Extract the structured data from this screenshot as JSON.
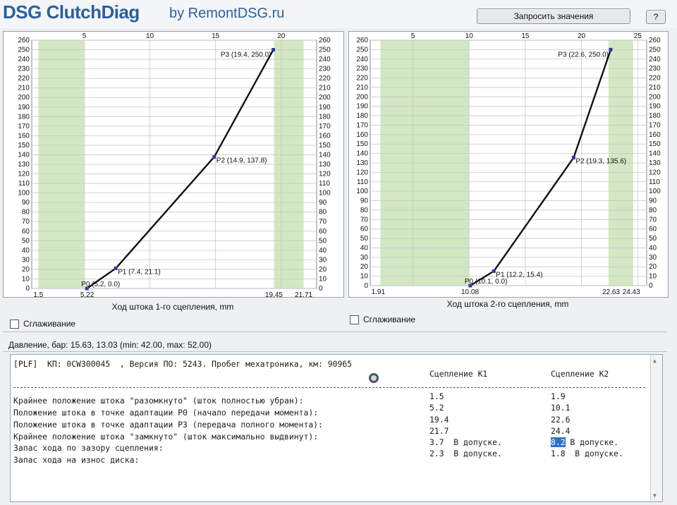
{
  "header": {
    "app_name": "DSG ClutchDiag",
    "app_by": "by RemontDSG.ru",
    "request_button": "Запросить значения",
    "help_button": "?"
  },
  "colors": {
    "brand": "#2b5f9c",
    "band": "#d2e8c3",
    "curve": "#111111",
    "grid": "#c8c8c8"
  },
  "chart_data": [
    {
      "type": "line",
      "xlabel": "Ход штока 1-го сцепления, mm",
      "x_ticks_top": [
        5,
        10,
        15,
        20
      ],
      "y_ticks": [
        0,
        10,
        20,
        30,
        40,
        50,
        60,
        70,
        80,
        90,
        100,
        110,
        120,
        130,
        140,
        150,
        160,
        170,
        180,
        190,
        200,
        210,
        220,
        230,
        240,
        250,
        260
      ],
      "xlim": [
        1.0,
        22.7
      ],
      "ylim": [
        0,
        260
      ],
      "bottom_markers": [
        "1.5",
        "5.22",
        "19.45",
        "21.71"
      ],
      "bottom_marker_values": [
        1.5,
        5.22,
        19.45,
        21.71
      ],
      "bands": [
        [
          1.5,
          5.0
        ],
        [
          19.45,
          21.71
        ]
      ],
      "series": [
        {
          "x": [
            5.2,
            7.4,
            14.9,
            19.4
          ],
          "y": [
            0.0,
            21.1,
            137.8,
            250.0
          ]
        }
      ],
      "point_labels": [
        "P0 (5.2, 0.0)",
        "P1 (7.4, 21.1)",
        "P2 (14.9, 137.8)",
        "P3 (19.4, 250.0)"
      ]
    },
    {
      "type": "line",
      "xlabel": "Ход штока 2-го сцепления, mm",
      "x_ticks_top": [
        5,
        10,
        15,
        20,
        25
      ],
      "y_ticks": [
        0,
        10,
        20,
        30,
        40,
        50,
        60,
        70,
        80,
        90,
        100,
        110,
        120,
        130,
        140,
        150,
        160,
        170,
        180,
        190,
        200,
        210,
        220,
        230,
        240,
        250,
        260
      ],
      "xlim": [
        1.2,
        25.8
      ],
      "ylim": [
        0,
        260
      ],
      "bottom_markers": [
        "1.91",
        "10.08",
        "22.63",
        "24.43"
      ],
      "bottom_marker_values": [
        1.91,
        10.08,
        22.63,
        24.43
      ],
      "bands": [
        [
          2.1,
          10.0
        ],
        [
          22.4,
          24.6
        ]
      ],
      "series": [
        {
          "x": [
            10.1,
            12.2,
            19.3,
            22.6
          ],
          "y": [
            0.0,
            15.4,
            135.6,
            250.0
          ]
        }
      ],
      "point_labels": [
        "P0 (10.1, 0.0)",
        "P1 (12.2, 15.4)",
        "P2 (19.3, 135.6)",
        "P3 (22.6, 250.0)"
      ]
    }
  ],
  "options": {
    "smoothing_label_1": "Сглаживание",
    "smoothing_label_2": "Сглаживание"
  },
  "status": {
    "pressure": "Давление, бар: 15.63, 13.03 (min: 42.00, max: 52.00)"
  },
  "report": {
    "header_line": "[PLF]  КП: 0CW300045  , Версия ПО: 5243. Пробег мехатроника, км: 90965",
    "col_k1": "Сцепление К1",
    "col_k2": "Сцепление К2",
    "rows": [
      {
        "label": "Крайнее положение штока \"разомкнуто\" (шток полностью убран):",
        "k1": "1.5",
        "k2": "1.9"
      },
      {
        "label": "Положение штока в точке адаптации P0 (начало передачи момента):",
        "k1": "5.2",
        "k2": "10.1"
      },
      {
        "label": "Положение штока в точке адаптации P3 (передача полного момента):",
        "k1": "19.4",
        "k2": "22.6"
      },
      {
        "label": "Крайнее положение штока \"замкнуто\" (шток максимально выдвинут):",
        "k1": "21.7",
        "k2": "24.4"
      },
      {
        "label": "Запас хода по зазору сцепления:",
        "k1": "3.7  В допуске.",
        "k2_value": "8.2",
        "k2_note": " В допуске."
      },
      {
        "label": "Запас хода на износ диска:",
        "k1": "2.3  В допуске.",
        "k2": "1.8  В допуске."
      }
    ]
  }
}
